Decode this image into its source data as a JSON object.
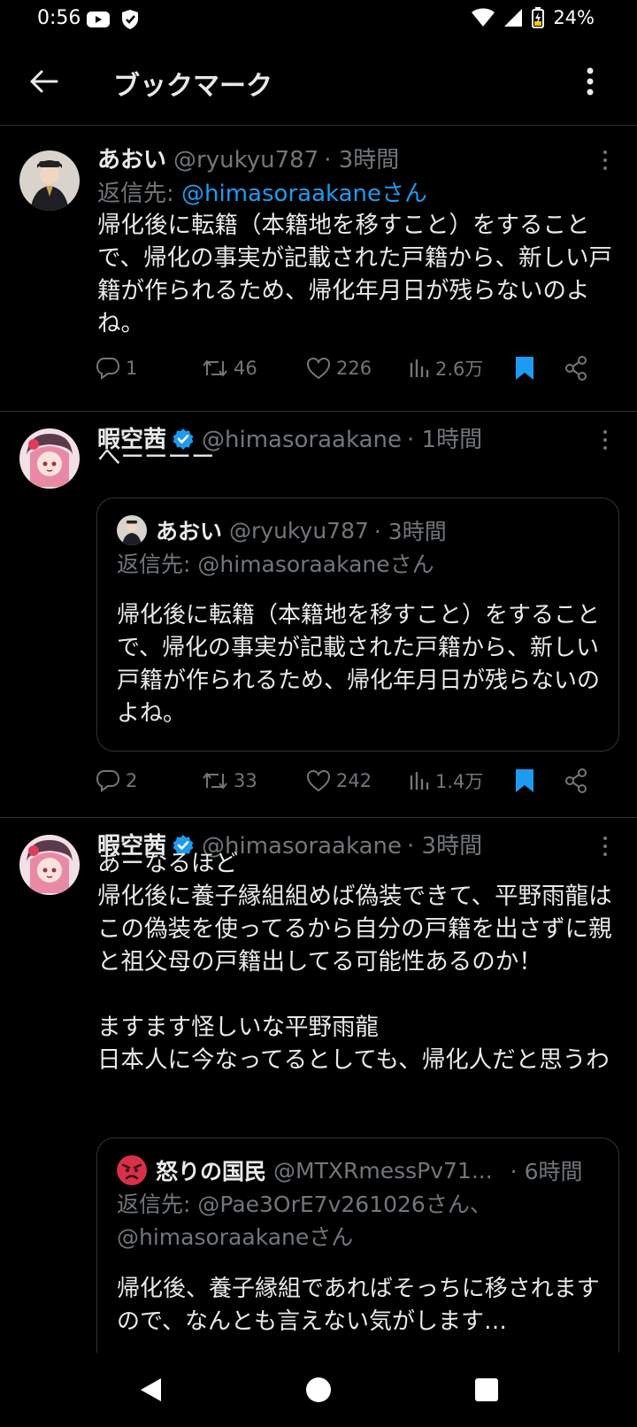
{
  "status_bar": {
    "time": "0:56",
    "battery": "24%"
  },
  "app_bar": {
    "title": "ブックマーク"
  },
  "tweets": [
    {
      "name": "あおい",
      "handle": "@ryukyu787",
      "time": "· 3時間",
      "reply_prefix": "返信先: ",
      "reply_to": "@himasoraakaneさん",
      "body": "帰化後に転籍（本籍地を移すこと）をすることで、帰化の事実が記載された戸籍から、新しい戸籍が作られるため、帰化年月日が残らないのよね。",
      "replies": "1",
      "retweets": "46",
      "likes": "226",
      "views": "2.6万"
    },
    {
      "name": "暇空茜",
      "handle": "@himasoraakane",
      "time": "· 1時間",
      "body": "へーーーー",
      "quote": {
        "name": "あおい",
        "handle": "@ryukyu787",
        "time": "· 3時間",
        "reply_to": "返信先: @himasoraakaneさん",
        "body": "帰化後に転籍（本籍地を移すこと）をすることで、帰化の事実が記載された戸籍から、新しい戸籍が作られるため、帰化年月日が残らないのよね。"
      },
      "replies": "2",
      "retweets": "33",
      "likes": "242",
      "views": "1.4万"
    },
    {
      "name": "暇空茜",
      "handle": "@himasoraakane",
      "time": "· 3時間",
      "body": "あーなるほど\n帰化後に養子縁組組めば偽装できて、平野雨龍はこの偽装を使ってるから自分の戸籍を出さずに親と祖父母の戸籍出してる可能性あるのか！\n\nますます怪しいな平野雨龍\n日本人に今なってるとしても、帰化人だと思うわ",
      "quote": {
        "name": "怒りの国民",
        "handle": "@MTXRmessPv71...",
        "time": "· 6時間",
        "reply_to": "返信先: @Pae3OrE7v261026さん、\n@himasoraakaneさん",
        "body": "帰化後、養子縁組であればそっちに移されますので、なんとも言えない気がします…"
      }
    }
  ]
}
